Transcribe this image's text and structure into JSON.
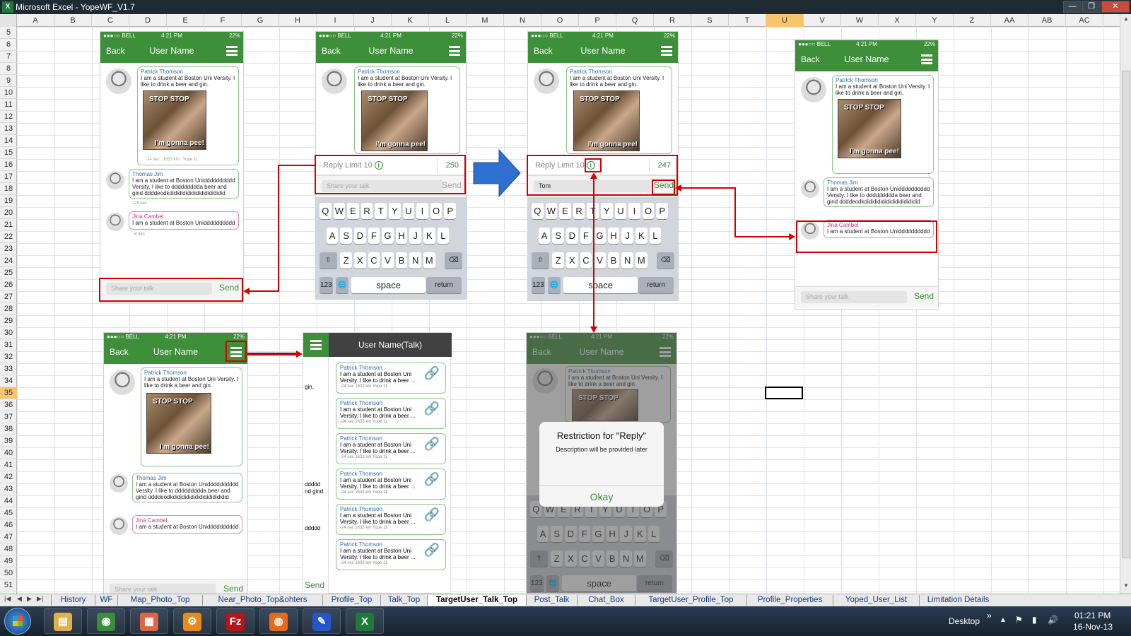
{
  "window": {
    "title": "Microsoft Excel - YopeWF_V1.7",
    "app_icon": "X",
    "minimize": "—",
    "restore": "❐",
    "close": "✕"
  },
  "columns": [
    "A",
    "B",
    "C",
    "D",
    "E",
    "F",
    "G",
    "H",
    "I",
    "J",
    "K",
    "L",
    "M",
    "N",
    "O",
    "P",
    "Q",
    "R",
    "S",
    "T",
    "U",
    "V",
    "W",
    "X",
    "Y",
    "Z",
    "AA",
    "AB",
    "AC"
  ],
  "selected_column": "U",
  "rows": [
    "5",
    "6",
    "7",
    "8",
    "9",
    "10",
    "11",
    "12",
    "13",
    "14",
    "15",
    "16",
    "17",
    "18",
    "19",
    "20",
    "21",
    "22",
    "23",
    "24",
    "25",
    "26",
    "27",
    "28",
    "29",
    "30",
    "31",
    "32",
    "33",
    "34",
    "35",
    "36",
    "37",
    "38",
    "39",
    "40",
    "41",
    "42",
    "43",
    "44",
    "45",
    "46",
    "47",
    "48",
    "49",
    "50",
    "51"
  ],
  "selected_row": "35",
  "sheet_tabs": [
    "History",
    "WF",
    "Map_Photo_Top",
    "Near_Photo_Top&ohters",
    "Profile_Top",
    "Talk_Top",
    "TargetUser_Talk_Top",
    "Post_Talk",
    "Chat_Box",
    "TargetUser_Profile_Top",
    "Profile_Properties",
    "Yoped_User_List",
    "Limitation Details"
  ],
  "active_tab": "TargetUser_Talk_Top",
  "phone": {
    "status_left": "●●●○○ BELL",
    "time": "4:21 PM",
    "battery": "22%",
    "back": "Back",
    "title": "User Name",
    "post1_name": "Patrick Thomson",
    "post1_text": "I am a student at Boston Uni Versity. I like to drink a beer and gin.",
    "photo_top": "STOP STOP",
    "photo_bottom": "I'm gonna pee!",
    "post1_meta1": "-24 sec",
    "post1_meta2": "1633 km",
    "post1_meta3": "Yope 11",
    "post2_name": "Thomas Jim",
    "post2_text": "I am a student at Boston Unidddddddddd Versity. I like to ddddddddda beer and gind ddddeodkdidididididididididididid",
    "post2_meta": "-24 sec",
    "post3_name": "Jina Cambel",
    "post3_text": "I am a student at Boston Unidddddddddd",
    "post3_meta": "-6 min",
    "share_placeholder": "Share your talk",
    "send": "Send",
    "reply_limit": "Reply Limit 10",
    "info": "i",
    "count_a": "250",
    "count_b": "247",
    "typed": "Tom",
    "key_row1": [
      "Q",
      "W",
      "E",
      "R",
      "T",
      "Y",
      "U",
      "I",
      "O",
      "P"
    ],
    "key_row2": [
      "A",
      "S",
      "D",
      "F",
      "G",
      "H",
      "J",
      "K",
      "L"
    ],
    "key_row3": [
      "Z",
      "X",
      "C",
      "V",
      "B",
      "N",
      "M"
    ],
    "key_shift": "⇧",
    "key_delete": "⌫",
    "key_123": "123",
    "key_globe": "🌐",
    "key_space": "space",
    "key_return": "return"
  },
  "menu_panel": {
    "header": "User Name(Talk)",
    "item_name": "Patrick Thomson",
    "item_text": "I am a student at Boston Uni Versity. I like to drink a beer ...",
    "item_meta": "-24 sec   1633 km   Yope 11",
    "link_icon": "🔗",
    "side_snippets": [
      "gin.",
      "ddddd",
      "nd gind",
      "ddddd"
    ]
  },
  "dialog": {
    "title": "Restriction for \"Reply\"",
    "desc": "Description will be provided later",
    "ok": "Okay"
  },
  "taskbar": {
    "desktop": "Desktop",
    "chevron": "»",
    "time": "01:21 PM",
    "date": "16-Nov-13",
    "apps": [
      "explorer",
      "chrome",
      "metro",
      "settings",
      "filezilla",
      "firefox",
      "paint",
      "excel"
    ]
  },
  "colors": {
    "green": "#3d8f3a",
    "red": "#d40000",
    "blue_arrow": "#2f6fcf"
  }
}
